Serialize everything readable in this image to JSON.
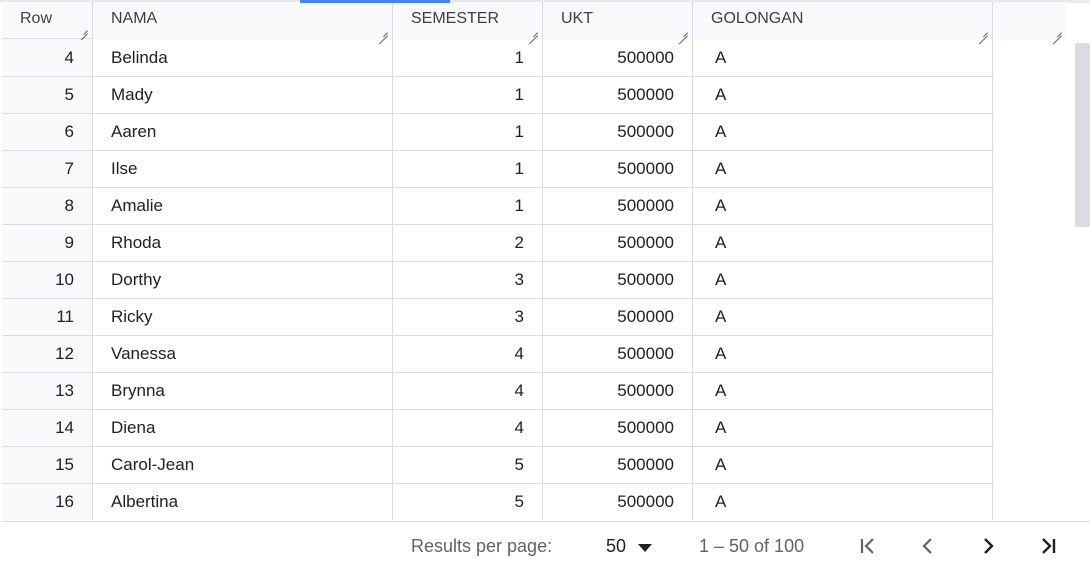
{
  "header": {
    "columns": [
      "Row",
      "NAMA",
      "SEMESTER",
      "UKT",
      "GOLONGAN"
    ]
  },
  "rows": [
    {
      "row": "4",
      "nama": "Belinda",
      "semester": "1",
      "ukt": "500000",
      "golongan": "A"
    },
    {
      "row": "5",
      "nama": "Mady",
      "semester": "1",
      "ukt": "500000",
      "golongan": "A"
    },
    {
      "row": "6",
      "nama": "Aaren",
      "semester": "1",
      "ukt": "500000",
      "golongan": "A"
    },
    {
      "row": "7",
      "nama": "Ilse",
      "semester": "1",
      "ukt": "500000",
      "golongan": "A"
    },
    {
      "row": "8",
      "nama": "Amalie",
      "semester": "1",
      "ukt": "500000",
      "golongan": "A"
    },
    {
      "row": "9",
      "nama": "Rhoda",
      "semester": "2",
      "ukt": "500000",
      "golongan": "A"
    },
    {
      "row": "10",
      "nama": "Dorthy",
      "semester": "3",
      "ukt": "500000",
      "golongan": "A"
    },
    {
      "row": "11",
      "nama": "Ricky",
      "semester": "3",
      "ukt": "500000",
      "golongan": "A"
    },
    {
      "row": "12",
      "nama": "Vanessa",
      "semester": "4",
      "ukt": "500000",
      "golongan": "A"
    },
    {
      "row": "13",
      "nama": "Brynna",
      "semester": "4",
      "ukt": "500000",
      "golongan": "A"
    },
    {
      "row": "14",
      "nama": "Diena",
      "semester": "4",
      "ukt": "500000",
      "golongan": "A"
    },
    {
      "row": "15",
      "nama": "Carol-Jean",
      "semester": "5",
      "ukt": "500000",
      "golongan": "A"
    },
    {
      "row": "16",
      "nama": "Albertina",
      "semester": "5",
      "ukt": "500000",
      "golongan": "A"
    }
  ],
  "footer": {
    "results_label": "Results per page:",
    "per_page": "50",
    "range": "1 – 50 of 100"
  },
  "icons": {
    "first_page": "first-page-icon",
    "prev_page": "chevron-left-icon",
    "next_page": "chevron-right-icon",
    "last_page": "last-page-icon",
    "dropdown": "caret-down-icon"
  },
  "colors": {
    "accent": "#4285f4",
    "header_bg": "#f8f9fa",
    "border": "#dadce0"
  }
}
